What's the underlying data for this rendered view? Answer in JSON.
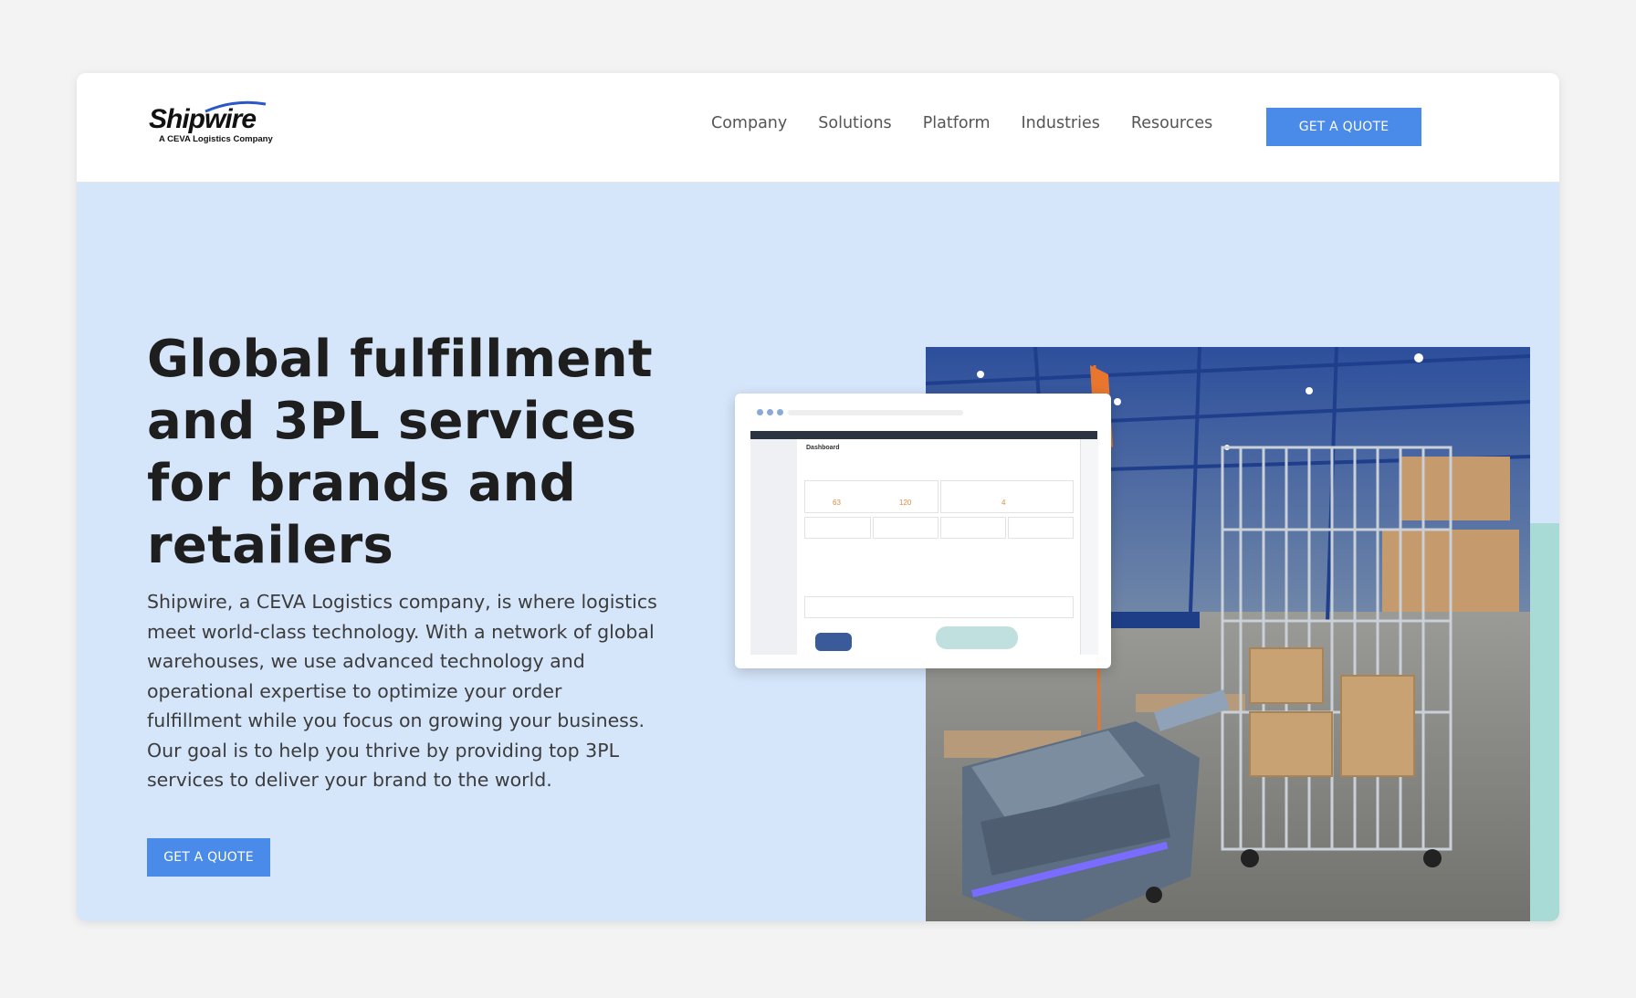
{
  "header": {
    "logo": {
      "name": "Shipwire",
      "tagline": "A CEVA Logistics Company"
    },
    "nav": [
      {
        "label": "Company"
      },
      {
        "label": "Solutions"
      },
      {
        "label": "Platform"
      },
      {
        "label": "Industries"
      },
      {
        "label": "Resources"
      }
    ],
    "cta_label": "GET A QUOTE"
  },
  "hero": {
    "headline": "Global fulfillment and 3PL services for brands and retailers",
    "description": "Shipwire, a CEVA Logistics company, is where logistics meet world-class technology. With a network of global warehouses, we use advanced technology and operational expertise to optimize your order fulfillment while you focus on growing your business. Our goal is to help you thrive by providing top 3PL services to deliver your brand to the world.",
    "cta_label": "GET A QUOTE"
  },
  "dashboard_preview": {
    "title": "Dashboard",
    "metrics": [
      "63",
      "120",
      "4"
    ]
  },
  "colors": {
    "accent": "#4a8ae8",
    "hero_bg": "#d5e5fa",
    "teal": "#a9dbd6"
  }
}
